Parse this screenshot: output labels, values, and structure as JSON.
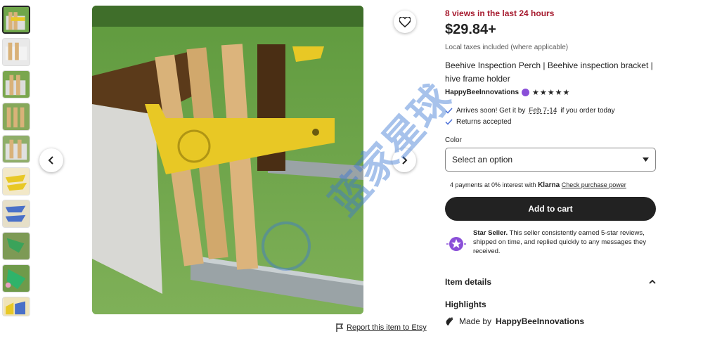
{
  "gallery": {
    "thumbnail_count": 10,
    "active_index": 0,
    "prev_icon": "chevron-left-icon",
    "next_icon": "chevron-right-icon",
    "favorite_icon": "heart-icon"
  },
  "report": {
    "icon": "flag-icon",
    "label": "Report this item to Etsy"
  },
  "listing": {
    "views": "8 views in the last 24 hours",
    "price": "$29.84+",
    "taxes": "Local taxes included (where applicable)",
    "title": "Beehive Inspection Perch | Beehive inspection bracket | hive frame holder",
    "seller": "HappyBeeInnovations",
    "rating_stars": "★★★★★",
    "rating": 5
  },
  "shipping": {
    "arrives_prefix": "Arrives soon! Get it by",
    "arrives_dates": "Feb 7-14",
    "arrives_suffix": "if you order today",
    "returns": "Returns accepted"
  },
  "color": {
    "label": "Color",
    "placeholder": "Select an option"
  },
  "klarna": {
    "text": "4 payments at 0% interest with",
    "brand": "Klarna",
    "link": "Check purchase power"
  },
  "cart": {
    "label": "Add to cart"
  },
  "star_seller": {
    "title": "Star Seller.",
    "text": "This seller consistently earned 5-star reviews, shipped on time, and replied quickly to any messages they received."
  },
  "details": {
    "item_details": "Item details",
    "highlights": "Highlights",
    "made_by_prefix": "Made by",
    "made_by_name": "HappyBeeInnovations"
  },
  "watermark": {
    "text": "蓝家星球"
  },
  "colors": {
    "views_red": "#a61a2e",
    "button_black": "#222222",
    "star_seller_purple": "#8a4fd8",
    "bracket_yellow": "#e8c825"
  }
}
